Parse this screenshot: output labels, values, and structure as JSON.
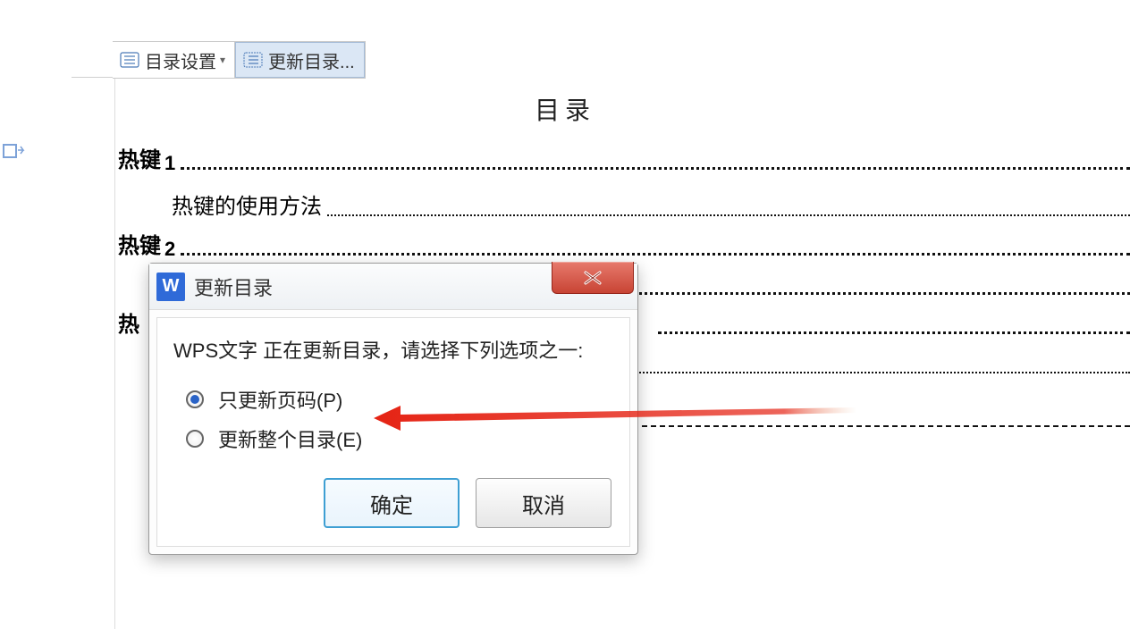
{
  "toolbar": {
    "settings_label": "目录设置",
    "update_label": "更新目录..."
  },
  "document": {
    "title": "目录",
    "entries": [
      {
        "level": 1,
        "label": "热键",
        "num": "1"
      },
      {
        "level": 2,
        "label": "热键的使用方法",
        "num": ""
      },
      {
        "level": 1,
        "label": "热键",
        "num": "2"
      },
      {
        "level": 1,
        "label": "热",
        "num": ""
      }
    ]
  },
  "dialog": {
    "app_icon": "W",
    "title": "更新目录",
    "message": "WPS文字 正在更新目录，请选择下列选项之一:",
    "options": {
      "page_only": "只更新页码(P)",
      "full": "更新整个目录(E)"
    },
    "buttons": {
      "ok": "确定",
      "cancel": "取消"
    }
  }
}
